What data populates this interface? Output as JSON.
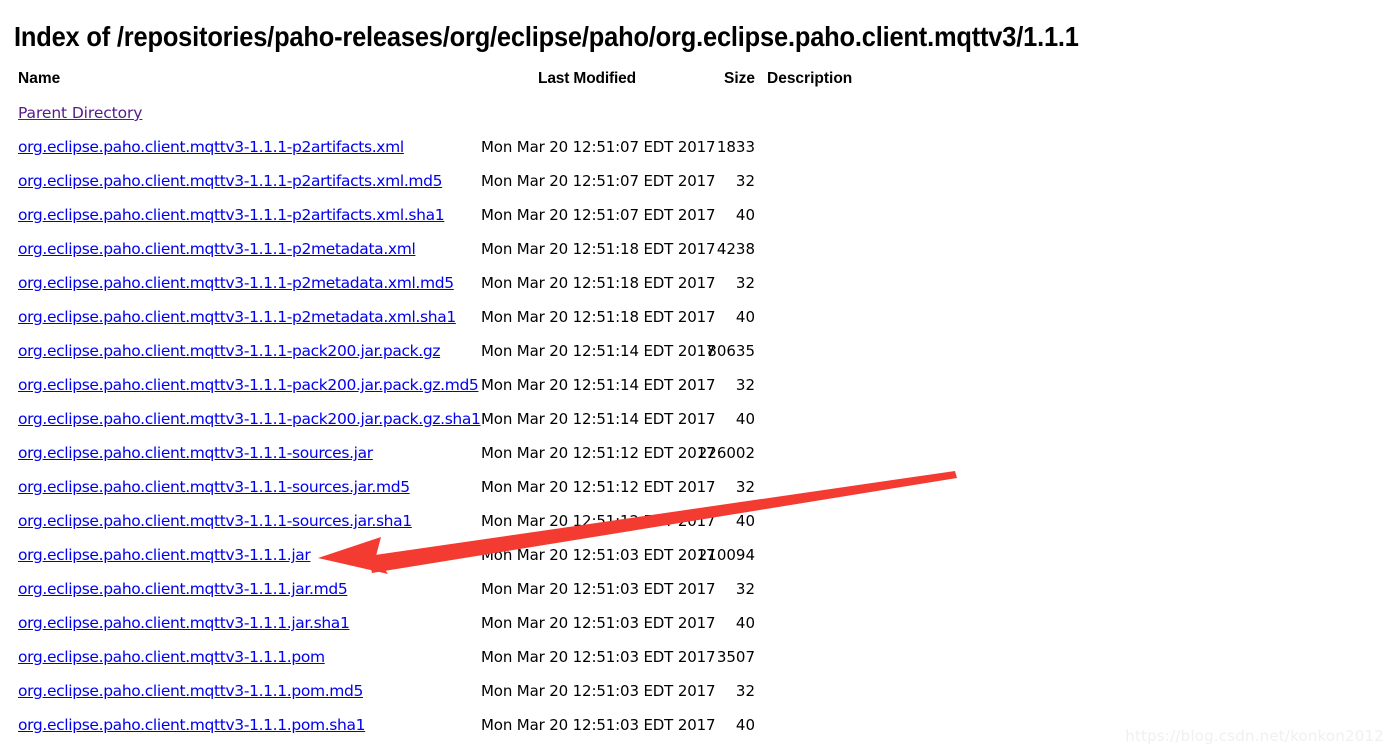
{
  "page": {
    "title": "Index of /repositories/paho-releases/org/eclipse/paho/org.eclipse.paho.client.mqttv3/1.1.1",
    "background_color": "#ffffff",
    "link_color": "#0000ee",
    "visited_link_color": "#551a8b"
  },
  "table": {
    "headers": {
      "name": "Name",
      "last_modified": "Last Modified",
      "size": "Size",
      "description": "Description"
    },
    "parent_directory_label": "Parent Directory",
    "rows": [
      {
        "name": "org.eclipse.paho.client.mqttv3-1.1.1-p2artifacts.xml",
        "last_modified": "Mon Mar 20 12:51:07 EDT 2017",
        "size": "1833",
        "description": ""
      },
      {
        "name": "org.eclipse.paho.client.mqttv3-1.1.1-p2artifacts.xml.md5",
        "last_modified": "Mon Mar 20 12:51:07 EDT 2017",
        "size": "32",
        "description": ""
      },
      {
        "name": "org.eclipse.paho.client.mqttv3-1.1.1-p2artifacts.xml.sha1",
        "last_modified": "Mon Mar 20 12:51:07 EDT 2017",
        "size": "40",
        "description": ""
      },
      {
        "name": "org.eclipse.paho.client.mqttv3-1.1.1-p2metadata.xml",
        "last_modified": "Mon Mar 20 12:51:18 EDT 2017",
        "size": "4238",
        "description": ""
      },
      {
        "name": "org.eclipse.paho.client.mqttv3-1.1.1-p2metadata.xml.md5",
        "last_modified": "Mon Mar 20 12:51:18 EDT 2017",
        "size": "32",
        "description": ""
      },
      {
        "name": "org.eclipse.paho.client.mqttv3-1.1.1-p2metadata.xml.sha1",
        "last_modified": "Mon Mar 20 12:51:18 EDT 2017",
        "size": "40",
        "description": ""
      },
      {
        "name": "org.eclipse.paho.client.mqttv3-1.1.1-pack200.jar.pack.gz",
        "last_modified": "Mon Mar 20 12:51:14 EDT 2017",
        "size": "80635",
        "description": ""
      },
      {
        "name": "org.eclipse.paho.client.mqttv3-1.1.1-pack200.jar.pack.gz.md5",
        "last_modified": "Mon Mar 20 12:51:14 EDT 2017",
        "size": "32",
        "description": ""
      },
      {
        "name": "org.eclipse.paho.client.mqttv3-1.1.1-pack200.jar.pack.gz.sha1",
        "last_modified": "Mon Mar 20 12:51:14 EDT 2017",
        "size": "40",
        "description": ""
      },
      {
        "name": "org.eclipse.paho.client.mqttv3-1.1.1-sources.jar",
        "last_modified": "Mon Mar 20 12:51:12 EDT 2017",
        "size": "226002",
        "description": ""
      },
      {
        "name": "org.eclipse.paho.client.mqttv3-1.1.1-sources.jar.md5",
        "last_modified": "Mon Mar 20 12:51:12 EDT 2017",
        "size": "32",
        "description": ""
      },
      {
        "name": "org.eclipse.paho.client.mqttv3-1.1.1-sources.jar.sha1",
        "last_modified": "Mon Mar 20 12:51:12 EDT 2017",
        "size": "40",
        "description": ""
      },
      {
        "name": "org.eclipse.paho.client.mqttv3-1.1.1.jar",
        "last_modified": "Mon Mar 20 12:51:03 EDT 2017",
        "size": "210094",
        "description": ""
      },
      {
        "name": "org.eclipse.paho.client.mqttv3-1.1.1.jar.md5",
        "last_modified": "Mon Mar 20 12:51:03 EDT 2017",
        "size": "32",
        "description": ""
      },
      {
        "name": "org.eclipse.paho.client.mqttv3-1.1.1.jar.sha1",
        "last_modified": "Mon Mar 20 12:51:03 EDT 2017",
        "size": "40",
        "description": ""
      },
      {
        "name": "org.eclipse.paho.client.mqttv3-1.1.1.pom",
        "last_modified": "Mon Mar 20 12:51:03 EDT 2017",
        "size": "3507",
        "description": ""
      },
      {
        "name": "org.eclipse.paho.client.mqttv3-1.1.1.pom.md5",
        "last_modified": "Mon Mar 20 12:51:03 EDT 2017",
        "size": "32",
        "description": ""
      },
      {
        "name": "org.eclipse.paho.client.mqttv3-1.1.1.pom.sha1",
        "last_modified": "Mon Mar 20 12:51:03 EDT 2017",
        "size": "40",
        "description": ""
      }
    ]
  },
  "annotation": {
    "arrow_color": "#f43b32",
    "points_at_row_name": "org.eclipse.paho.client.mqttv3-1.1.1.jar"
  },
  "watermark": {
    "text": "https://blog.csdn.net/konkon2012",
    "color": "#f0f0f0"
  }
}
